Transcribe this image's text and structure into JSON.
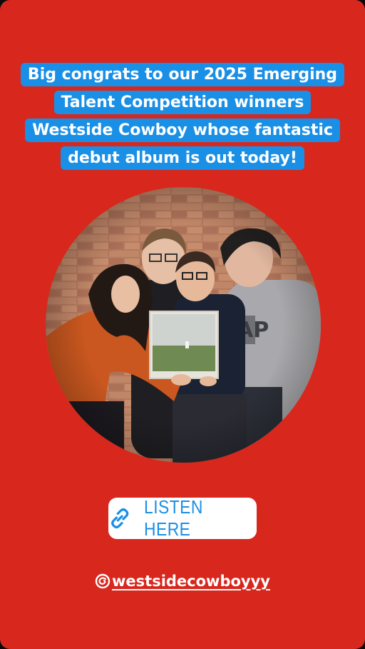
{
  "story": {
    "background_color": "#d8271d",
    "headline_lines": [
      "Big congrats to our 2025 Emerging",
      "Talent Competition winners",
      "Westside Cowboy whose fantastic",
      "debut album is out today!"
    ],
    "headline_highlight_color": "#1a8fe6",
    "photo": {
      "description_icon": "band-photo",
      "album_cover_icon": "album-cover",
      "sweatshirt_text": "AP"
    },
    "link_sticker": {
      "icon": "link-icon",
      "label": "LISTEN HERE",
      "color": "#1a8fe6"
    },
    "mention": {
      "icon": "threads-icon",
      "handle": "westsidecowboyyy"
    }
  }
}
